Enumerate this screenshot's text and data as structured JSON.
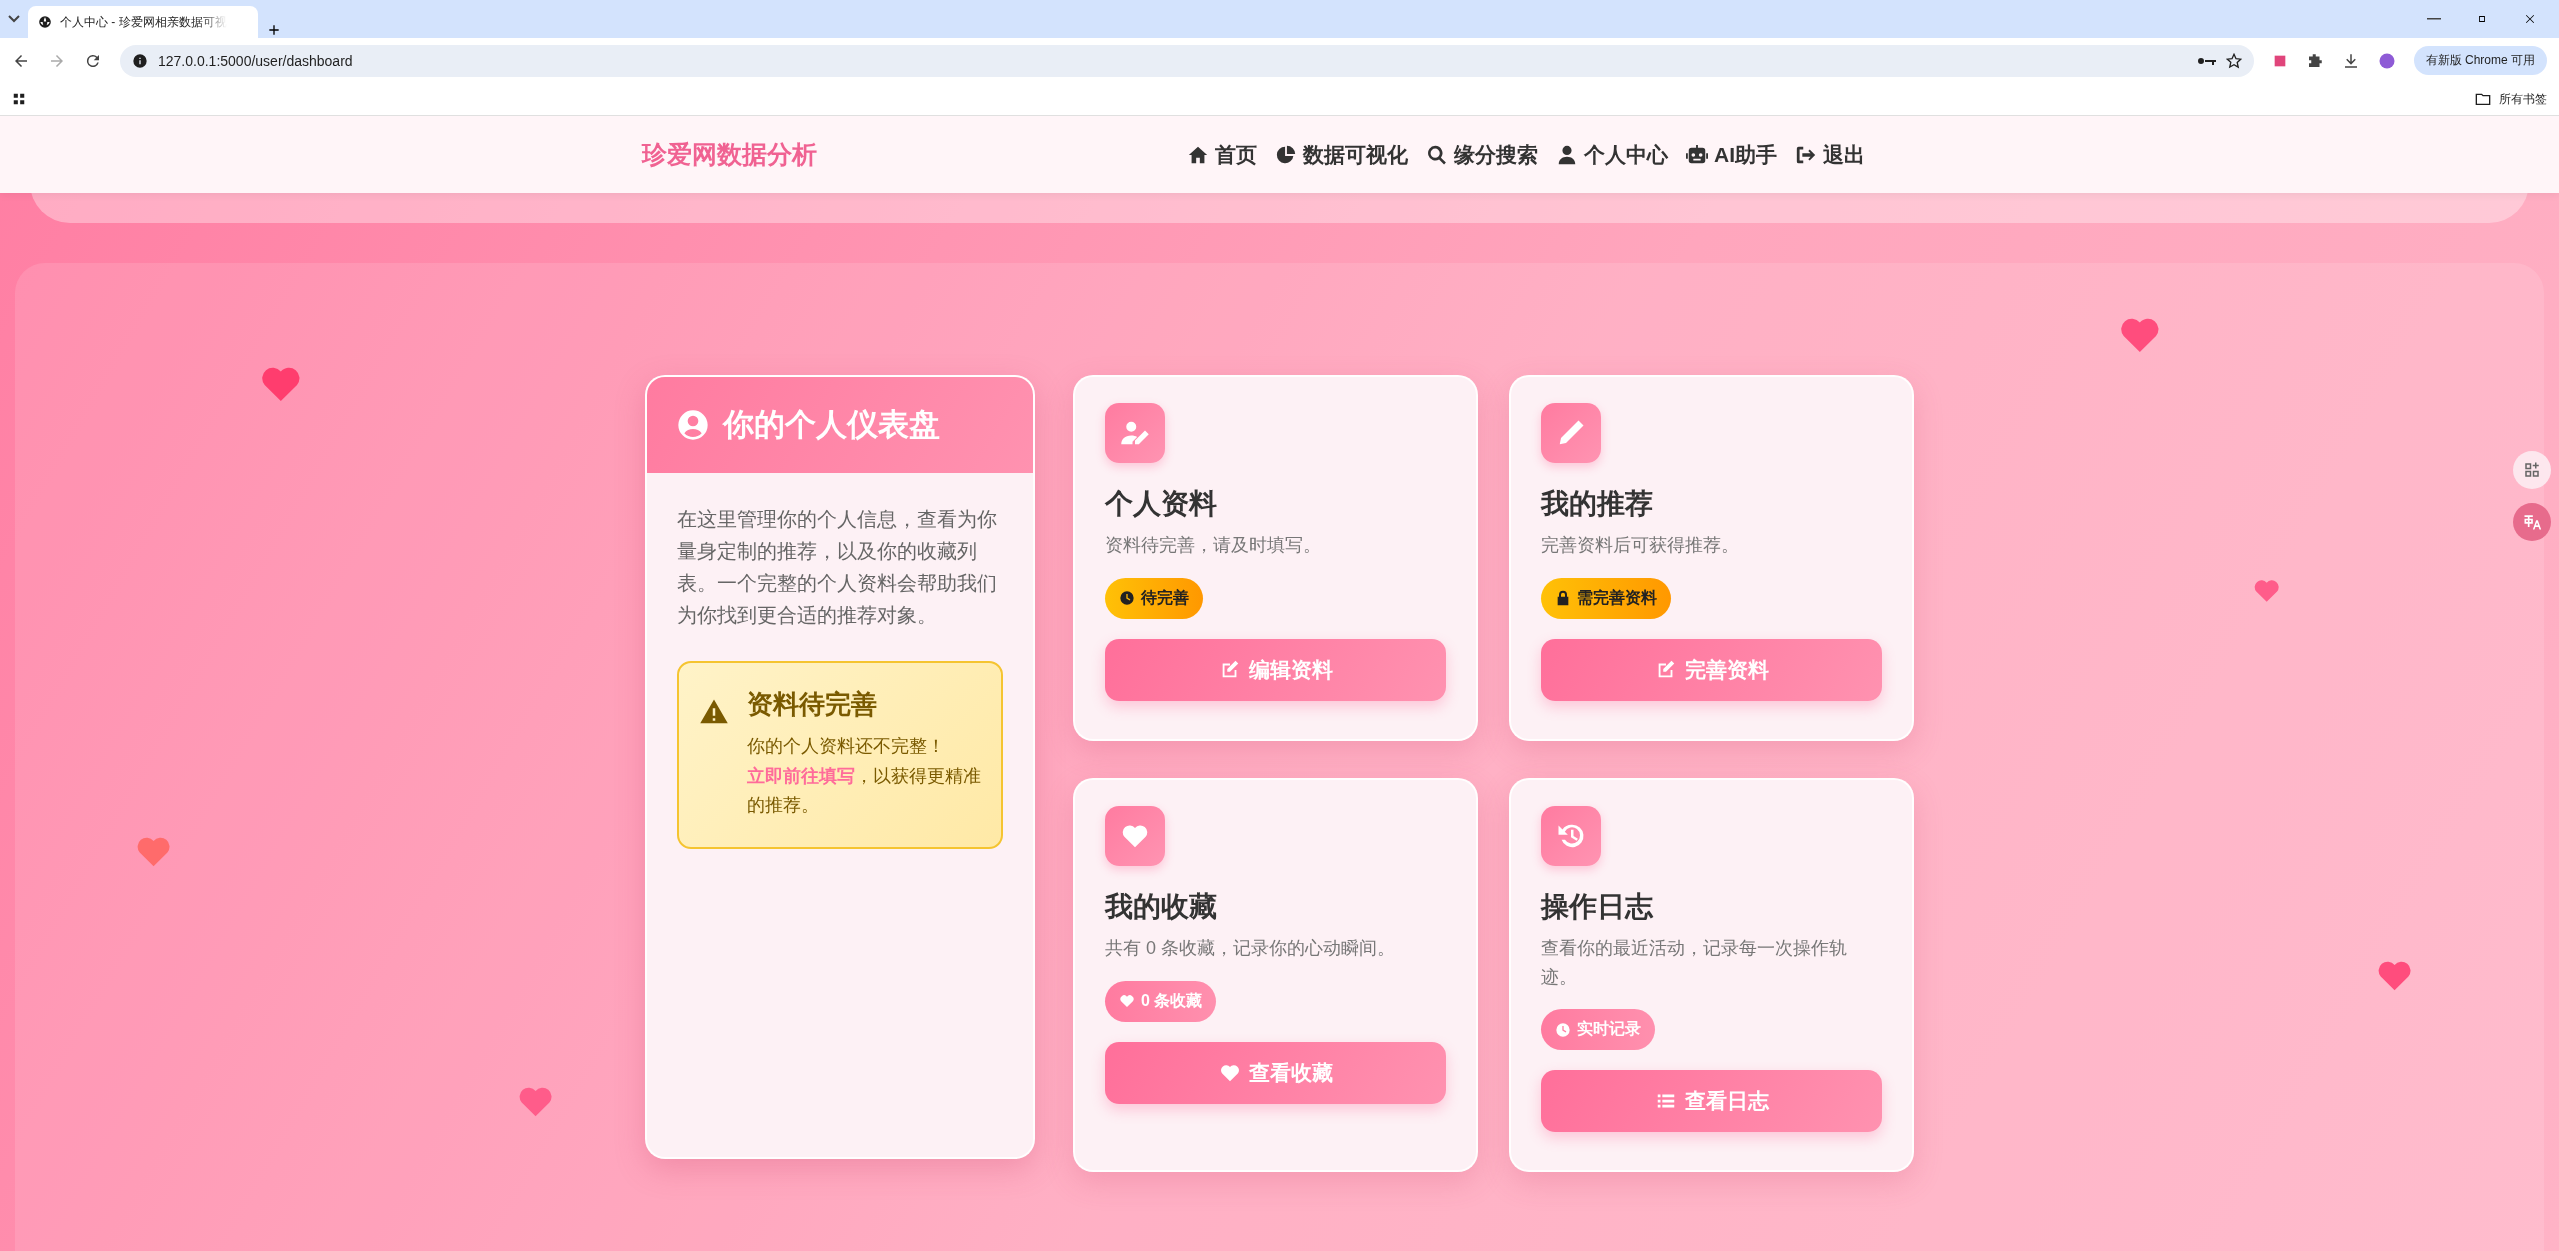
{
  "browser": {
    "tab_title": "个人中心 - 珍爱网相亲数据可视",
    "url": "127.0.0.1:5000/user/dashboard",
    "update_button": "有新版 Chrome 可用",
    "bookmarks_label": "所有书签"
  },
  "nav": {
    "brand": "珍爱网数据分析",
    "items": [
      {
        "label": "首页"
      },
      {
        "label": "数据可视化"
      },
      {
        "label": "缘分搜索"
      },
      {
        "label": "个人中心"
      },
      {
        "label": "AI助手"
      },
      {
        "label": "退出"
      }
    ]
  },
  "dashboard": {
    "title": "你的个人仪表盘",
    "intro": "在这里管理你的个人信息，查看为你量身定制的推荐，以及你的收藏列表。一个完整的个人资料会帮助我们为你找到更合适的推荐对象。",
    "alert": {
      "title": "资料待完善",
      "text_before": "你的个人资料还不完整！",
      "link": "立即前往填写",
      "text_after": "，以获得更精准的推荐。"
    }
  },
  "cards": [
    {
      "title": "个人资料",
      "description": "资料待完善，请及时填写。",
      "badge": {
        "label": "待完善",
        "kind": "warning"
      },
      "button": "编辑资料"
    },
    {
      "title": "我的推荐",
      "description": "完善资料后可获得推荐。",
      "badge": {
        "label": "需完善资料",
        "kind": "warning"
      },
      "button": "完善资料"
    },
    {
      "title": "我的收藏",
      "description": "共有 0 条收藏，记录你的心动瞬间。",
      "badge": {
        "label": "0 条收藏",
        "kind": "info"
      },
      "button": "查看收藏"
    },
    {
      "title": "操作日志",
      "description": "查看你的最近活动，记录每一次操作轨迹。",
      "badge": {
        "label": "实时记录",
        "kind": "info"
      },
      "button": "查看日志"
    }
  ]
}
